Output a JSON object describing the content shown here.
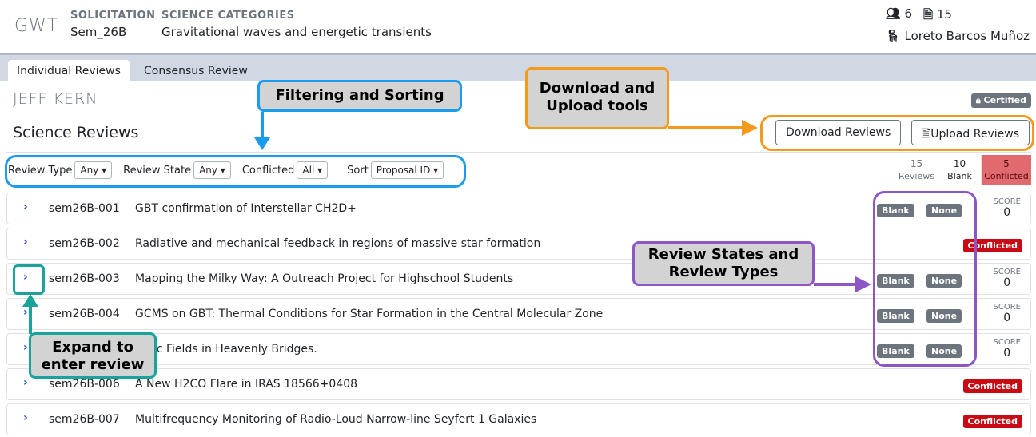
{
  "header": {
    "logo": "GWT",
    "solicitation_label": "SOLICITATION",
    "solicitation_value": "Sem_26B",
    "categories_label": "SCIENCE CATEGORIES",
    "categories_value": "Gravitational waves and energetic transients",
    "members_count": "6",
    "documents_count": "15",
    "user_name": "Loreto Barcos Muñoz",
    "icons": [
      "users-icon",
      "file-icon",
      "chair-icon"
    ]
  },
  "tabs": [
    {
      "label": "Individual Reviews",
      "active": true
    },
    {
      "label": "Consensus Review",
      "active": false
    }
  ],
  "reviewer": {
    "name": "JEFF KERN",
    "certified_label": "Certified"
  },
  "section": {
    "title": "Science Reviews",
    "download_label": "Download Reviews",
    "upload_label": "Upload Reviews"
  },
  "filters": {
    "review_type_label": "Review Type",
    "review_type_value": "Any ▾",
    "review_state_label": "Review State",
    "review_state_value": "Any ▾",
    "conflicted_label": "Conflicted",
    "conflicted_value": "All ▾",
    "sort_label": "Sort",
    "sort_value": "Proposal ID ▾"
  },
  "stats": {
    "reviews_num": "15",
    "reviews_label": "Reviews",
    "blank_num": "10",
    "blank_label": "Blank",
    "conflicted_num": "5",
    "conflicted_label": "Conflicted"
  },
  "rows": [
    {
      "id": "sem26B-001",
      "title": "GBT confirmation of Interstellar CH2D+",
      "state": "Blank",
      "type": "None",
      "score_label": "SCORE",
      "score": "0"
    },
    {
      "id": "sem26B-002",
      "title": "Radiative and mechanical feedback in regions of massive star formation",
      "conflicted": "Conflicted"
    },
    {
      "id": "sem26B-003",
      "title": "Mapping the Milky Way: A Outreach Project for Highschool Students",
      "state": "Blank",
      "type": "None",
      "score_label": "SCORE",
      "score": "0"
    },
    {
      "id": "sem26B-004",
      "title": "GCMS on GBT: Thermal Conditions for Star Formation in the Central Molecular Zone",
      "state": "Blank",
      "type": "None",
      "score_label": "SCORE",
      "score": "0"
    },
    {
      "id": "",
      "title": "netic Fields in Heavenly Bridges.",
      "state": "Blank",
      "type": "None",
      "score_label": "SCORE",
      "score": "0"
    },
    {
      "id": "sem26B-006",
      "title": "A New H2CO Flare in IRAS 18566+0408",
      "conflicted": "Conflicted"
    },
    {
      "id": "sem26B-007",
      "title": "Multifrequency Monitoring of Radio-Loud Narrow-line Seyfert 1 Galaxies",
      "conflicted": "Conflicted"
    }
  ],
  "callouts": {
    "filtering": "Filtering and Sorting",
    "download_1": "Download and",
    "download_2": "Upload tools",
    "states_1": "Review States and",
    "states_2": "Review Types",
    "expand_1": "Expand to",
    "expand_2": "enter review"
  },
  "colors": {
    "blue": "#1a9bec",
    "orange": "#f39a1d",
    "purple": "#8e55c4",
    "teal": "#1aa39a",
    "conflicted_red": "#c90a12"
  }
}
